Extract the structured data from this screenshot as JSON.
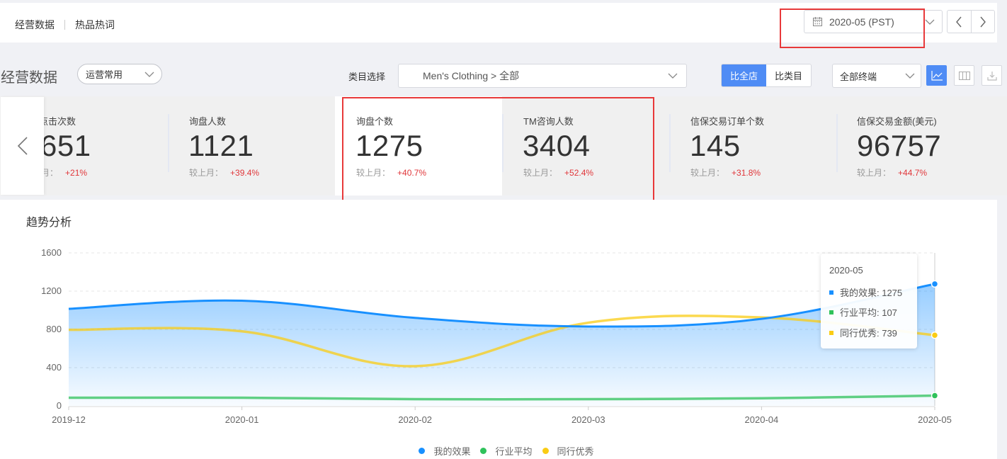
{
  "topbar": {
    "nav": [
      "经营数据",
      "热品热词"
    ],
    "date_value": "2020-05 (PST)",
    "prev_label": "<",
    "next_label": ">"
  },
  "filters": {
    "page_title": "经营数据",
    "preset_select": "运营常用",
    "category_label": "类目选择",
    "category_value": "Men's Clothing > 全部",
    "compare_tabs": [
      {
        "label": "比全店",
        "active": true
      },
      {
        "label": "比类目",
        "active": false
      }
    ],
    "terminal_select": "全部终端",
    "view_buttons": [
      "line-chart-icon",
      "table-columns-icon",
      "download-icon"
    ]
  },
  "metrics": {
    "compare_label": "较上月：",
    "items": [
      {
        "label": "点击次数",
        "value": "651",
        "change": "+21%",
        "compare": "月："
      },
      {
        "label": "询盘人数",
        "value": "1121",
        "change": "+39.4%"
      },
      {
        "label": "询盘个数",
        "value": "1275",
        "change": "+40.7%",
        "selected": true
      },
      {
        "label": "TM咨询人数",
        "value": "3404",
        "change": "+52.4%"
      },
      {
        "label": "信保交易订单个数",
        "value": "145",
        "change": "+31.8%"
      },
      {
        "label": "信保交易金额(美元)",
        "value": "96757",
        "change": "+44.7%"
      }
    ]
  },
  "trend": {
    "title": "趋势分析",
    "tooltip": {
      "title": "2020-05",
      "rows": [
        {
          "label": "我的效果: 1275",
          "color": "#1890ff"
        },
        {
          "label": "行业平均: 107",
          "color": "#2fc25b"
        },
        {
          "label": "同行优秀: 739",
          "color": "#facc14"
        }
      ]
    }
  },
  "chart_data": {
    "type": "area",
    "title": "趋势分析",
    "xlabel": "",
    "ylabel": "",
    "categories": [
      "2019-12",
      "2020-01",
      "2020-02",
      "2020-03",
      "2020-04",
      "2020-05"
    ],
    "yticks": [
      0,
      400,
      800,
      1200,
      1600
    ],
    "ylim": [
      0,
      1600
    ],
    "grid": true,
    "legend": "bottom-center",
    "series": [
      {
        "name": "我的效果",
        "color": "#1890ff",
        "values": [
          1015,
          1100,
          920,
          830,
          910,
          1275
        ],
        "area": true
      },
      {
        "name": "行业平均",
        "color": "#2fc25b",
        "values": [
          85,
          85,
          70,
          70,
          80,
          107
        ]
      },
      {
        "name": "同行优秀",
        "color": "#facc14",
        "values": [
          795,
          780,
          415,
          870,
          925,
          739
        ]
      }
    ],
    "highlight_category": "2020-05"
  }
}
